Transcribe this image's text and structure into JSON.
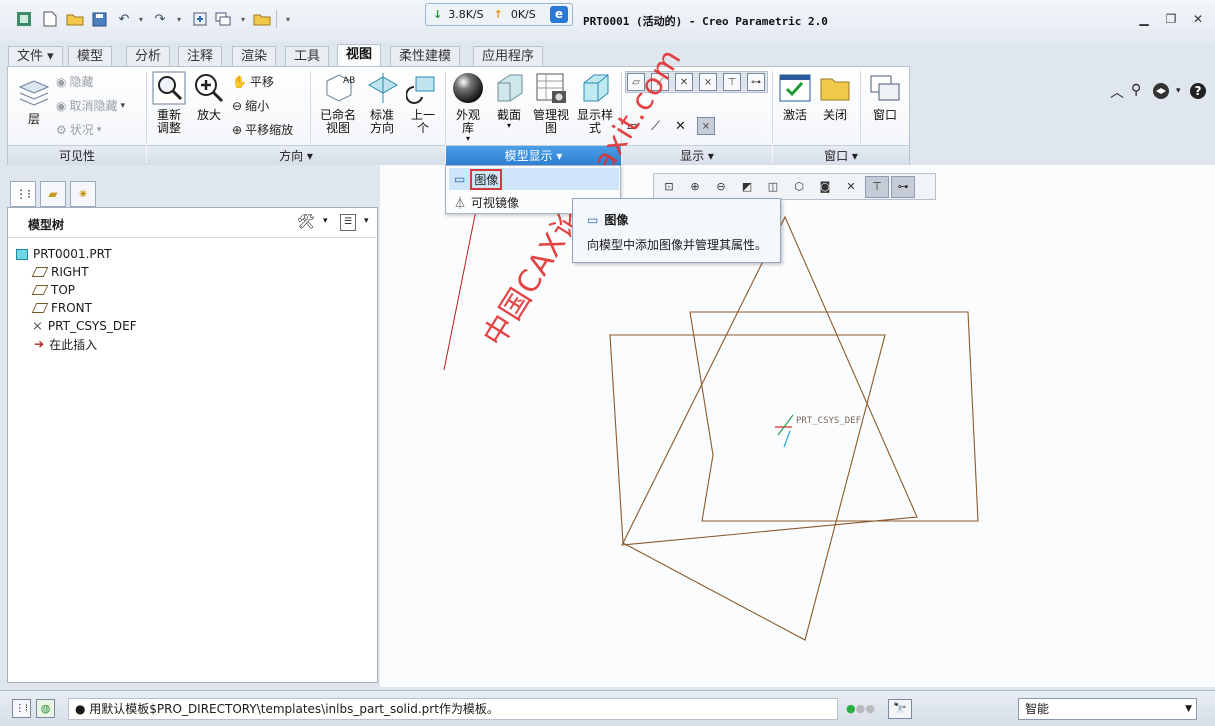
{
  "app": {
    "title": "PRT0001 (活动的) - Creo Parametric 2.0",
    "net_down": "3.8K/S",
    "net_up": "0K/S"
  },
  "window_controls": [
    "minimize-icon",
    "restore-icon",
    "close-icon"
  ],
  "ribbon_tabs": [
    {
      "label": "文件 ▾"
    },
    {
      "label": "模型"
    },
    {
      "label": "分析"
    },
    {
      "label": "注释"
    },
    {
      "label": "渲染"
    },
    {
      "label": "工具"
    },
    {
      "label": "视图"
    },
    {
      "label": "柔性建模"
    },
    {
      "label": "应用程序"
    }
  ],
  "ribbon": {
    "visibility": {
      "layers": "层",
      "hide": "隐藏",
      "unhide": "取消隐藏",
      "status": "状况",
      "group_label": "可见性"
    },
    "orientation": {
      "refit": "重新调整",
      "zoom_in": "放大",
      "pan": "平移",
      "zoom_out": "缩小",
      "pan_zoom": "平移缩放",
      "named_views": "已命名视图",
      "standard_orientation": "标准方向",
      "previous": "上一个",
      "group_label": "方向 ▾"
    },
    "model_display": {
      "appearance_gallery": "外观库",
      "section": "截面",
      "manage_views": "管理视图",
      "display_style": "显示样式",
      "group_label": "模型显示 ▾"
    },
    "show": {
      "group_label": "显示 ▾"
    },
    "window": {
      "activate": "激活",
      "close": "关闭",
      "windows": "窗口",
      "group_label": "窗口 ▾"
    }
  },
  "dropdown": {
    "items": [
      {
        "label": "图像",
        "icon": "image-icon"
      },
      {
        "label": "可视镜像",
        "icon": "mirror-icon"
      }
    ]
  },
  "tooltip": {
    "title": "图像",
    "body": "向模型中添加图像并管理其属性。"
  },
  "model_tree": {
    "title": "模型树",
    "items": [
      {
        "label": "PRT0001.PRT",
        "icon": "part-icon"
      },
      {
        "label": "RIGHT",
        "icon": "datum-plane-icon"
      },
      {
        "label": "TOP",
        "icon": "datum-plane-icon"
      },
      {
        "label": "FRONT",
        "icon": "datum-plane-icon"
      },
      {
        "label": "PRT_CSYS_DEF",
        "icon": "csys-icon"
      },
      {
        "label": "在此插入",
        "icon": "insert-arrow-icon"
      }
    ]
  },
  "graphics": {
    "csys_label": "PRT_CSYS_DEF",
    "datum_color": "#8a5a2a",
    "watermark": "中国CAX论坛caxit.com"
  },
  "status": {
    "message": "● 用默认模板$PRO_DIRECTORY\\templates\\inlbs_part_solid.prt作为模板。",
    "filter": "智能"
  }
}
